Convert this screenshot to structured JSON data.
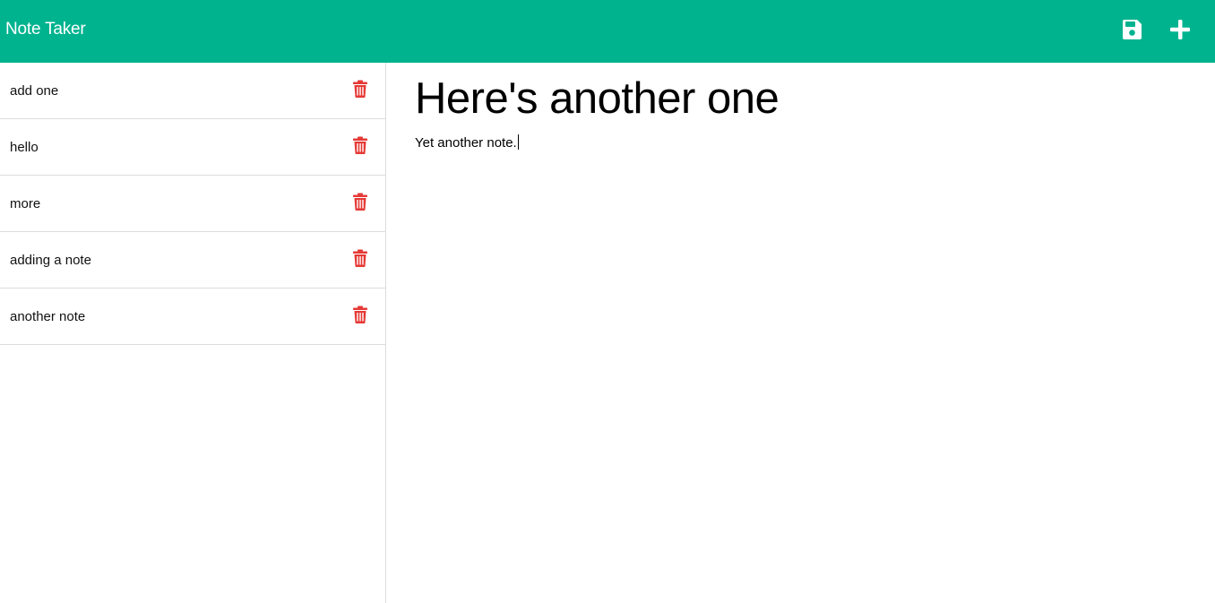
{
  "app": {
    "title": "Note Taker"
  },
  "toolbar": {
    "save_icon": "save-icon",
    "new_icon": "plus-icon",
    "icon_color": "#ffffff",
    "bg_color": "#00b38f"
  },
  "sidebar": {
    "items": [
      {
        "label": "add one"
      },
      {
        "label": "hello"
      },
      {
        "label": "more"
      },
      {
        "label": "adding a note"
      },
      {
        "label": "another note"
      }
    ],
    "delete_icon": "trash-icon",
    "delete_color": "#e53935"
  },
  "editor": {
    "title": "Here's another one",
    "body": "Yet another note."
  }
}
